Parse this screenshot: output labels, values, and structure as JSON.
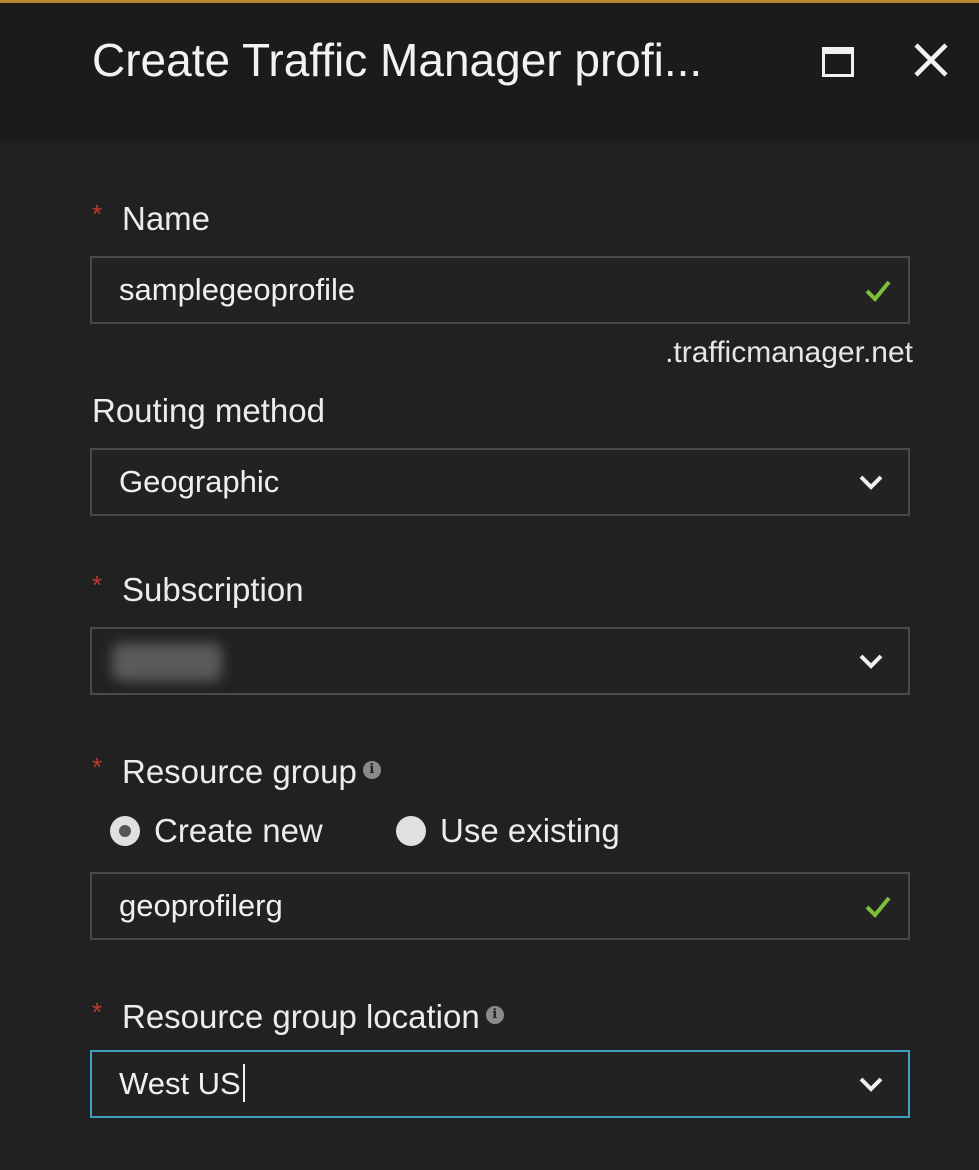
{
  "header": {
    "title": "Create Traffic Manager profi..."
  },
  "form": {
    "name": {
      "label": "Name",
      "value": "samplegeoprofile",
      "suffix": ".trafficmanager.net",
      "required_marker": "*"
    },
    "routing_method": {
      "label": "Routing method",
      "value": "Geographic"
    },
    "subscription": {
      "label": "Subscription",
      "required_marker": "*"
    },
    "resource_group": {
      "label": "Resource group",
      "required_marker": "*",
      "info_icon": "i",
      "option_create_new": "Create new",
      "option_use_existing": "Use existing",
      "selected_option": "Create new",
      "value": "geoprofilerg"
    },
    "resource_group_location": {
      "label": "Resource group location",
      "required_marker": "*",
      "info_icon": "i",
      "value": "West US"
    }
  },
  "icons": {
    "maximize": "maximize-icon",
    "close": "close-icon",
    "valid": "checkmark-icon",
    "dropdown": "chevron-down-icon",
    "info": "info-icon"
  },
  "colors": {
    "background": "#212121",
    "header_background": "#1b1b1b",
    "accent_top": "#b8862d",
    "required": "#c0392b",
    "valid_check": "#7cbf3a",
    "focus_border": "#3fa0bf"
  }
}
